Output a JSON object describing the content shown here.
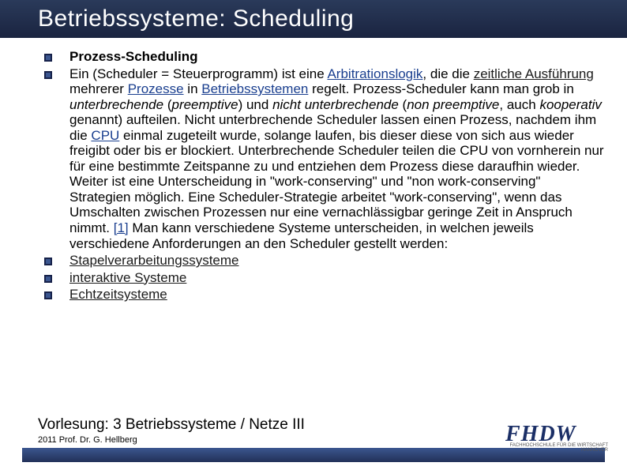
{
  "title": "Betriebssysteme: Scheduling",
  "bullets": {
    "b0": "Prozess-Scheduling",
    "b1_pre": "Ein  (Scheduler = Steuerprogramm) ist eine ",
    "b1_link1": "Arbitrationslogik",
    "b1_mid1": ", die die ",
    "b1_link2": "zeitliche Ausführung",
    "b1_mid2": " mehrerer ",
    "b1_link3": "Prozesse",
    "b1_mid3": " in ",
    "b1_link4": "Betriebssystemen",
    "b1_mid4": " regelt. Prozess-Scheduler kann man grob in ",
    "b1_em1": "unterbrechende",
    "b1_mid5": " (",
    "b1_em2": "preemptive",
    "b1_mid6": ") und ",
    "b1_em3": "nicht unterbrechende",
    "b1_mid7": " (",
    "b1_em4": "non preemptive",
    "b1_mid8": ", auch ",
    "b1_em5": "kooperativ",
    "b1_mid9": " genannt) aufteilen. Nicht unterbrechende Scheduler lassen einen Prozess, nachdem ihm die ",
    "b1_link5": "CPU",
    "b1_mid10": " einmal zugeteilt wurde, solange laufen, bis dieser diese von sich aus wieder freigibt oder bis er blockiert. Unterbrechende Scheduler teilen die CPU von vornherein nur für eine bestimmte Zeitspanne zu und entziehen dem Prozess diese daraufhin wieder. Weiter ist eine Unterscheidung in \"work-conserving\" und \"non work-conserving\" Strategien möglich. Eine Scheduler-Strategie arbeitet \"work-conserving\", wenn das Umschalten zwischen Prozessen nur eine vernachlässigbar geringe Zeit in Anspruch nimmt. ",
    "b1_link6": "[1]",
    "b1_end": " Man kann verschiedene Systeme unterscheiden, in welchen jeweils verschiedene Anforderungen an den Scheduler gestellt werden:",
    "b2": "Stapelverarbeitungssysteme",
    "b3": "interaktive Systeme",
    "b4": "Echtzeitsysteme"
  },
  "footer": {
    "lecture_label": "Vorlesung: ",
    "lecture_num": "3",
    "lecture_title": " Betriebssysteme / Netze III",
    "sub": "2011 Prof. Dr. G. Hellberg"
  },
  "logo": {
    "text": "FHDW",
    "sub1": "FACHHOCHSCHULE FÜR DIE WIRTSCHAFT",
    "sub2": "HANNOVER"
  }
}
